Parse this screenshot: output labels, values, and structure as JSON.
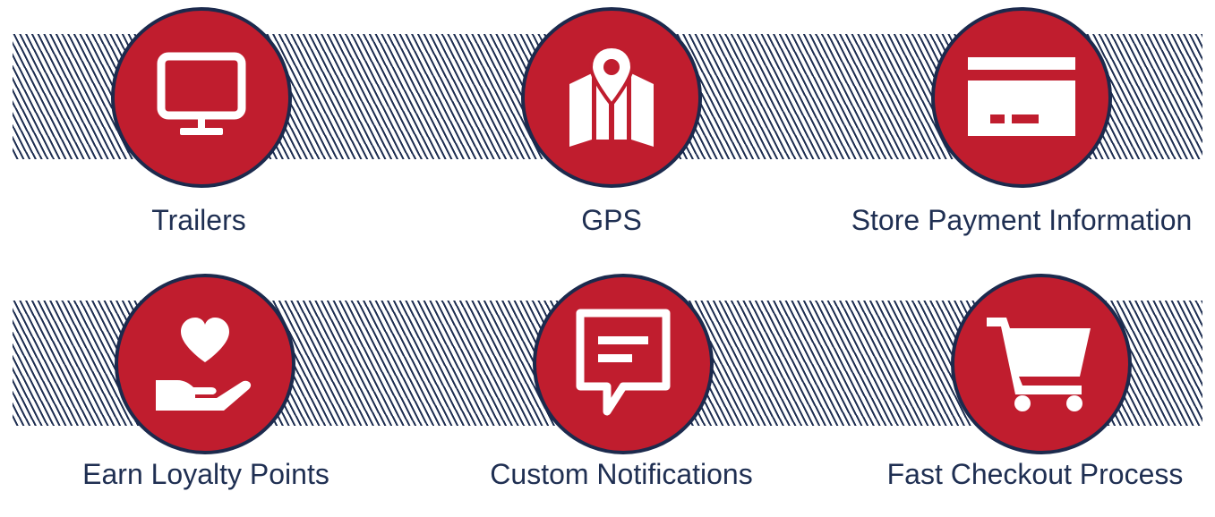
{
  "features": [
    {
      "label": "Trailers",
      "icon": "monitor-icon"
    },
    {
      "label": "GPS",
      "icon": "map-pin-icon"
    },
    {
      "label": "Store Payment Information",
      "icon": "credit-card-icon"
    },
    {
      "label": "Earn Loyalty Points",
      "icon": "heart-hand-icon"
    },
    {
      "label": "Custom Notifications",
      "icon": "chat-message-icon"
    },
    {
      "label": "Fast Checkout Process",
      "icon": "shopping-cart-icon"
    }
  ],
  "colors": {
    "circle_fill": "#c01d2e",
    "circle_border": "#1c2a4d",
    "stripes": "#1f2f52",
    "label_text": "#1f2f52",
    "icon": "#ffffff"
  }
}
